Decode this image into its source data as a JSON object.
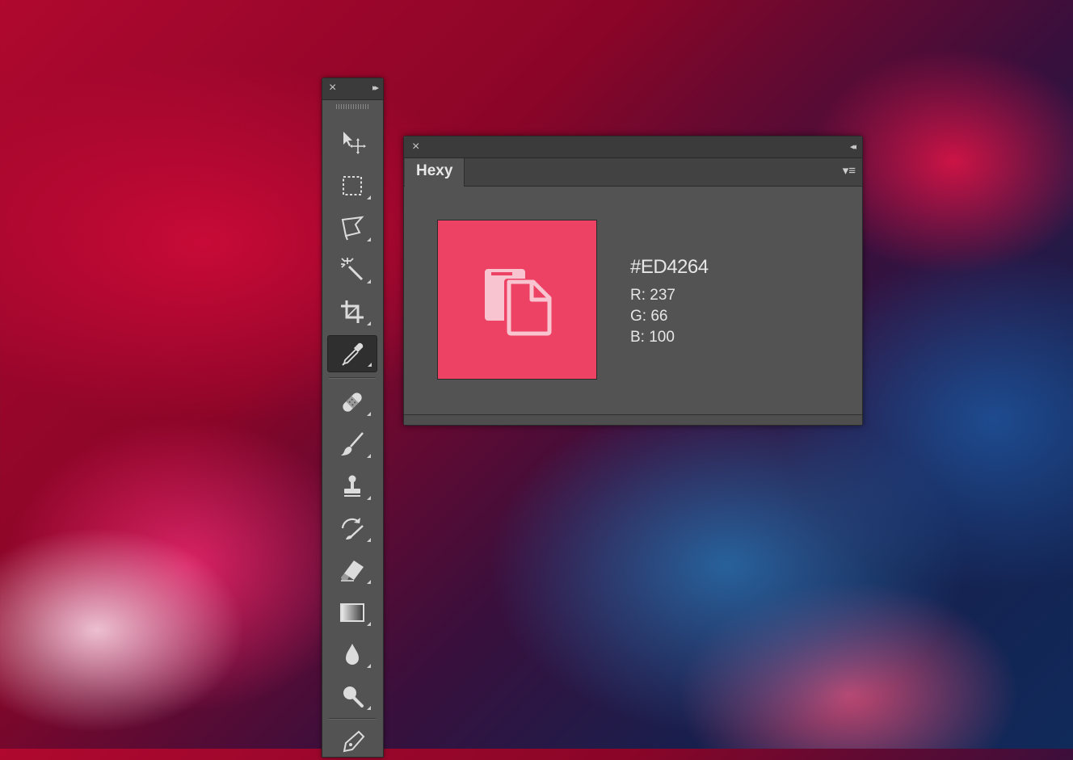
{
  "toolbar": {
    "close_glyph": "×",
    "collapse_glyph": "▸▸",
    "tools": [
      {
        "name": "move-tool",
        "icon": "move-icon"
      },
      {
        "name": "rectangular-marquee-tool",
        "icon": "marquee-icon"
      },
      {
        "name": "polygonal-lasso-tool",
        "icon": "lasso-icon"
      },
      {
        "name": "magic-wand-tool",
        "icon": "magic-wand-icon"
      },
      {
        "name": "crop-tool",
        "icon": "crop-icon"
      },
      {
        "name": "eyedropper-tool",
        "icon": "eyedropper-icon",
        "selected": true
      },
      {
        "name": "healing-brush-tool",
        "icon": "bandage-icon"
      },
      {
        "name": "brush-tool",
        "icon": "brush-icon"
      },
      {
        "name": "clone-stamp-tool",
        "icon": "stamp-icon"
      },
      {
        "name": "history-brush-tool",
        "icon": "history-brush-icon"
      },
      {
        "name": "eraser-tool",
        "icon": "eraser-icon"
      },
      {
        "name": "gradient-tool",
        "icon": "gradient-icon"
      },
      {
        "name": "blur-tool",
        "icon": "drop-icon"
      },
      {
        "name": "dodge-tool",
        "icon": "dodge-icon"
      },
      {
        "name": "pen-tool",
        "icon": "pen-icon"
      }
    ]
  },
  "panel": {
    "close_glyph": "×",
    "collapse_glyph": "◂◂",
    "tab_label": "Hexy",
    "menu_glyph": "▾≡",
    "swatch_color": "#ED4264",
    "copy_icon": "copy-icon",
    "hex": "#ED4264",
    "r": "R: 237",
    "g": "G: 66",
    "b": "B: 100"
  }
}
